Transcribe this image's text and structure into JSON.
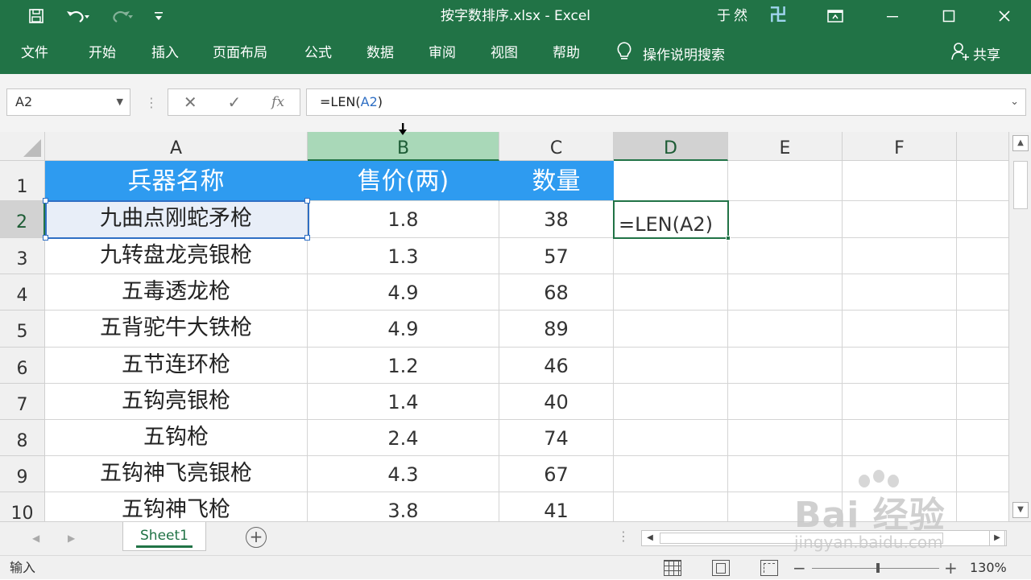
{
  "titlebar": {
    "title": "按字数排序.xlsx  -  Excel",
    "user": "于然",
    "logo": "卍",
    "save_icon": "save-icon",
    "undo_icon": "undo-icon",
    "redo_icon": "redo-icon",
    "customize_icon": "customize-qat-icon"
  },
  "ribbon": {
    "tabs": [
      "文件",
      "开始",
      "插入",
      "页面布局",
      "公式",
      "数据",
      "审阅",
      "视图",
      "帮助"
    ],
    "tell_me": "操作说明搜索",
    "share": "共享"
  },
  "formula_bar": {
    "name_box": "A2",
    "formula_prefix": "=LEN(",
    "formula_ref": "A2",
    "formula_suffix": ")",
    "fx": "fx"
  },
  "grid": {
    "columns": [
      "A",
      "B",
      "C",
      "D",
      "E",
      "F"
    ],
    "rows": [
      "1",
      "2",
      "3",
      "4",
      "5",
      "6",
      "7",
      "8",
      "9",
      "10"
    ],
    "header_row": [
      "兵器名称",
      "售价(两)",
      "数量"
    ],
    "data": [
      [
        "九曲点刚蛇矛枪",
        "1.8",
        "38"
      ],
      [
        "九转盘龙亮银枪",
        "1.3",
        "57"
      ],
      [
        "五毒透龙枪",
        "4.9",
        "68"
      ],
      [
        "五背驼牛大铁枪",
        "4.9",
        "89"
      ],
      [
        "五节连环枪",
        "1.2",
        "46"
      ],
      [
        "五钩亮银枪",
        "1.4",
        "40"
      ],
      [
        "五钩枪",
        "2.4",
        "74"
      ],
      [
        "五钩神飞亮银枪",
        "4.3",
        "67"
      ],
      [
        "五钩神飞枪",
        "3.8",
        "41"
      ]
    ],
    "editing_cell": "D2",
    "editing_text": "=LEN(A2)",
    "header_fill": "#2e9bf0"
  },
  "sheets": {
    "tabs": [
      "Sheet1"
    ],
    "active": "Sheet1"
  },
  "statusbar": {
    "mode": "输入",
    "zoom": "130%"
  },
  "watermark": {
    "brand": "Bai 经验",
    "url": "jingyan.baidu.com"
  },
  "colors": {
    "excel_green": "#217346",
    "selection_blue": "#2f6fc4"
  }
}
